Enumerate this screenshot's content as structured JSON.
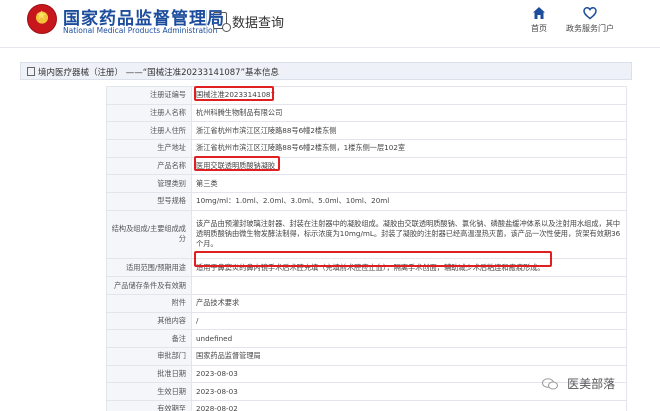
{
  "header": {
    "logo_cn": "国家药品监督管理局",
    "logo_en": "National Medical Products Administration",
    "data_query": "数据查询",
    "nav": [
      {
        "label": "首页",
        "icon": "home-icon"
      },
      {
        "label": "政务服务门户",
        "icon": "heart-icon"
      }
    ]
  },
  "breadcrumb": "境内医疗器械（注册） ——“国械注准20233141087”基本信息",
  "rows": [
    {
      "label": "注册证编号",
      "value": "国械注准20233141087"
    },
    {
      "label": "注册人名称",
      "value": "杭州科腾生物制品有限公司"
    },
    {
      "label": "注册人住所",
      "value": "浙江省杭州市滨江区江陵路88号6幢2楼东侧"
    },
    {
      "label": "生产地址",
      "value": "浙江省杭州市滨江区江陵路88号6幢2楼东侧，1楼东侧一层102室"
    },
    {
      "label": "产品名称",
      "value": "医用交联透明质酸钠凝胶"
    },
    {
      "label": "管理类别",
      "value": "第三类"
    },
    {
      "label": "型号规格",
      "value": "10mg/ml：1.0ml、2.0ml、3.0ml、5.0ml、10ml、20ml"
    },
    {
      "label": "结构及组成/主要组成成分",
      "value": "该产品由预灌封玻璃注射器、封装在注射器中的凝胶组成。凝胶由交联透明质酸钠、氯化钠、磷酸盐缓冲体系以及注射用水组成，其中透明质酸钠由微生物发酵法制得，标示浓度为10mg/mL。封装了凝胶的注射器已经高温湿热灭菌，该产品一次性使用，货架有效期36个月。"
    },
    {
      "label": "适用范围/预期用途",
      "value": "适用于鼻窦炎的鼻内镜手术后术腔充填（充填前术腔应止血），隔离手术创面，辅助减少术后粘连和瘢痕形成。"
    },
    {
      "label": "产品储存条件及有效期",
      "value": ""
    },
    {
      "label": "附件",
      "value": "产品技术要求"
    },
    {
      "label": "其他内容",
      "value": "/"
    },
    {
      "label": "备注",
      "value": "undefined"
    },
    {
      "label": "审批部门",
      "value": "国家药品监督管理局"
    },
    {
      "label": "批准日期",
      "value": "2023-08-03"
    },
    {
      "label": "生效日期",
      "value": "2023-08-03"
    },
    {
      "label": "有效期至",
      "value": "2028-08-02"
    }
  ],
  "watermark": "医美部落",
  "colors": {
    "brand_blue": "#1c4d9c",
    "highlight_red": "#e02020",
    "label_bg": "#f4f6fa"
  }
}
